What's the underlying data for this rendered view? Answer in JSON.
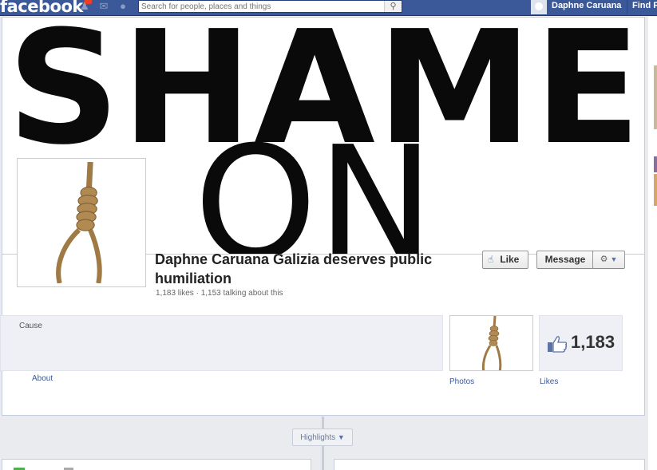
{
  "topbar": {
    "logo": "facebook",
    "search_placeholder": "Search for people, places and things",
    "user_name": "Daphne Caruana",
    "find_label": "Find F"
  },
  "cover": {
    "line1": "SHAME",
    "line2": "ON"
  },
  "page": {
    "name": "Daphne Caruana Galizia deserves public humiliation",
    "stats": "1,183 likes · 1,153 talking about this",
    "like_button": "Like",
    "message_button": "Message"
  },
  "about": {
    "category": "Cause",
    "about_label": "About"
  },
  "apps": {
    "photos_label": "Photos",
    "likes_count": "1,183",
    "likes_label": "Likes"
  },
  "timeline": {
    "highlights_label": "Highlights"
  },
  "colors": {
    "fb_blue": "#3b5998",
    "link": "#3b5998",
    "background": "#e9ebee"
  }
}
